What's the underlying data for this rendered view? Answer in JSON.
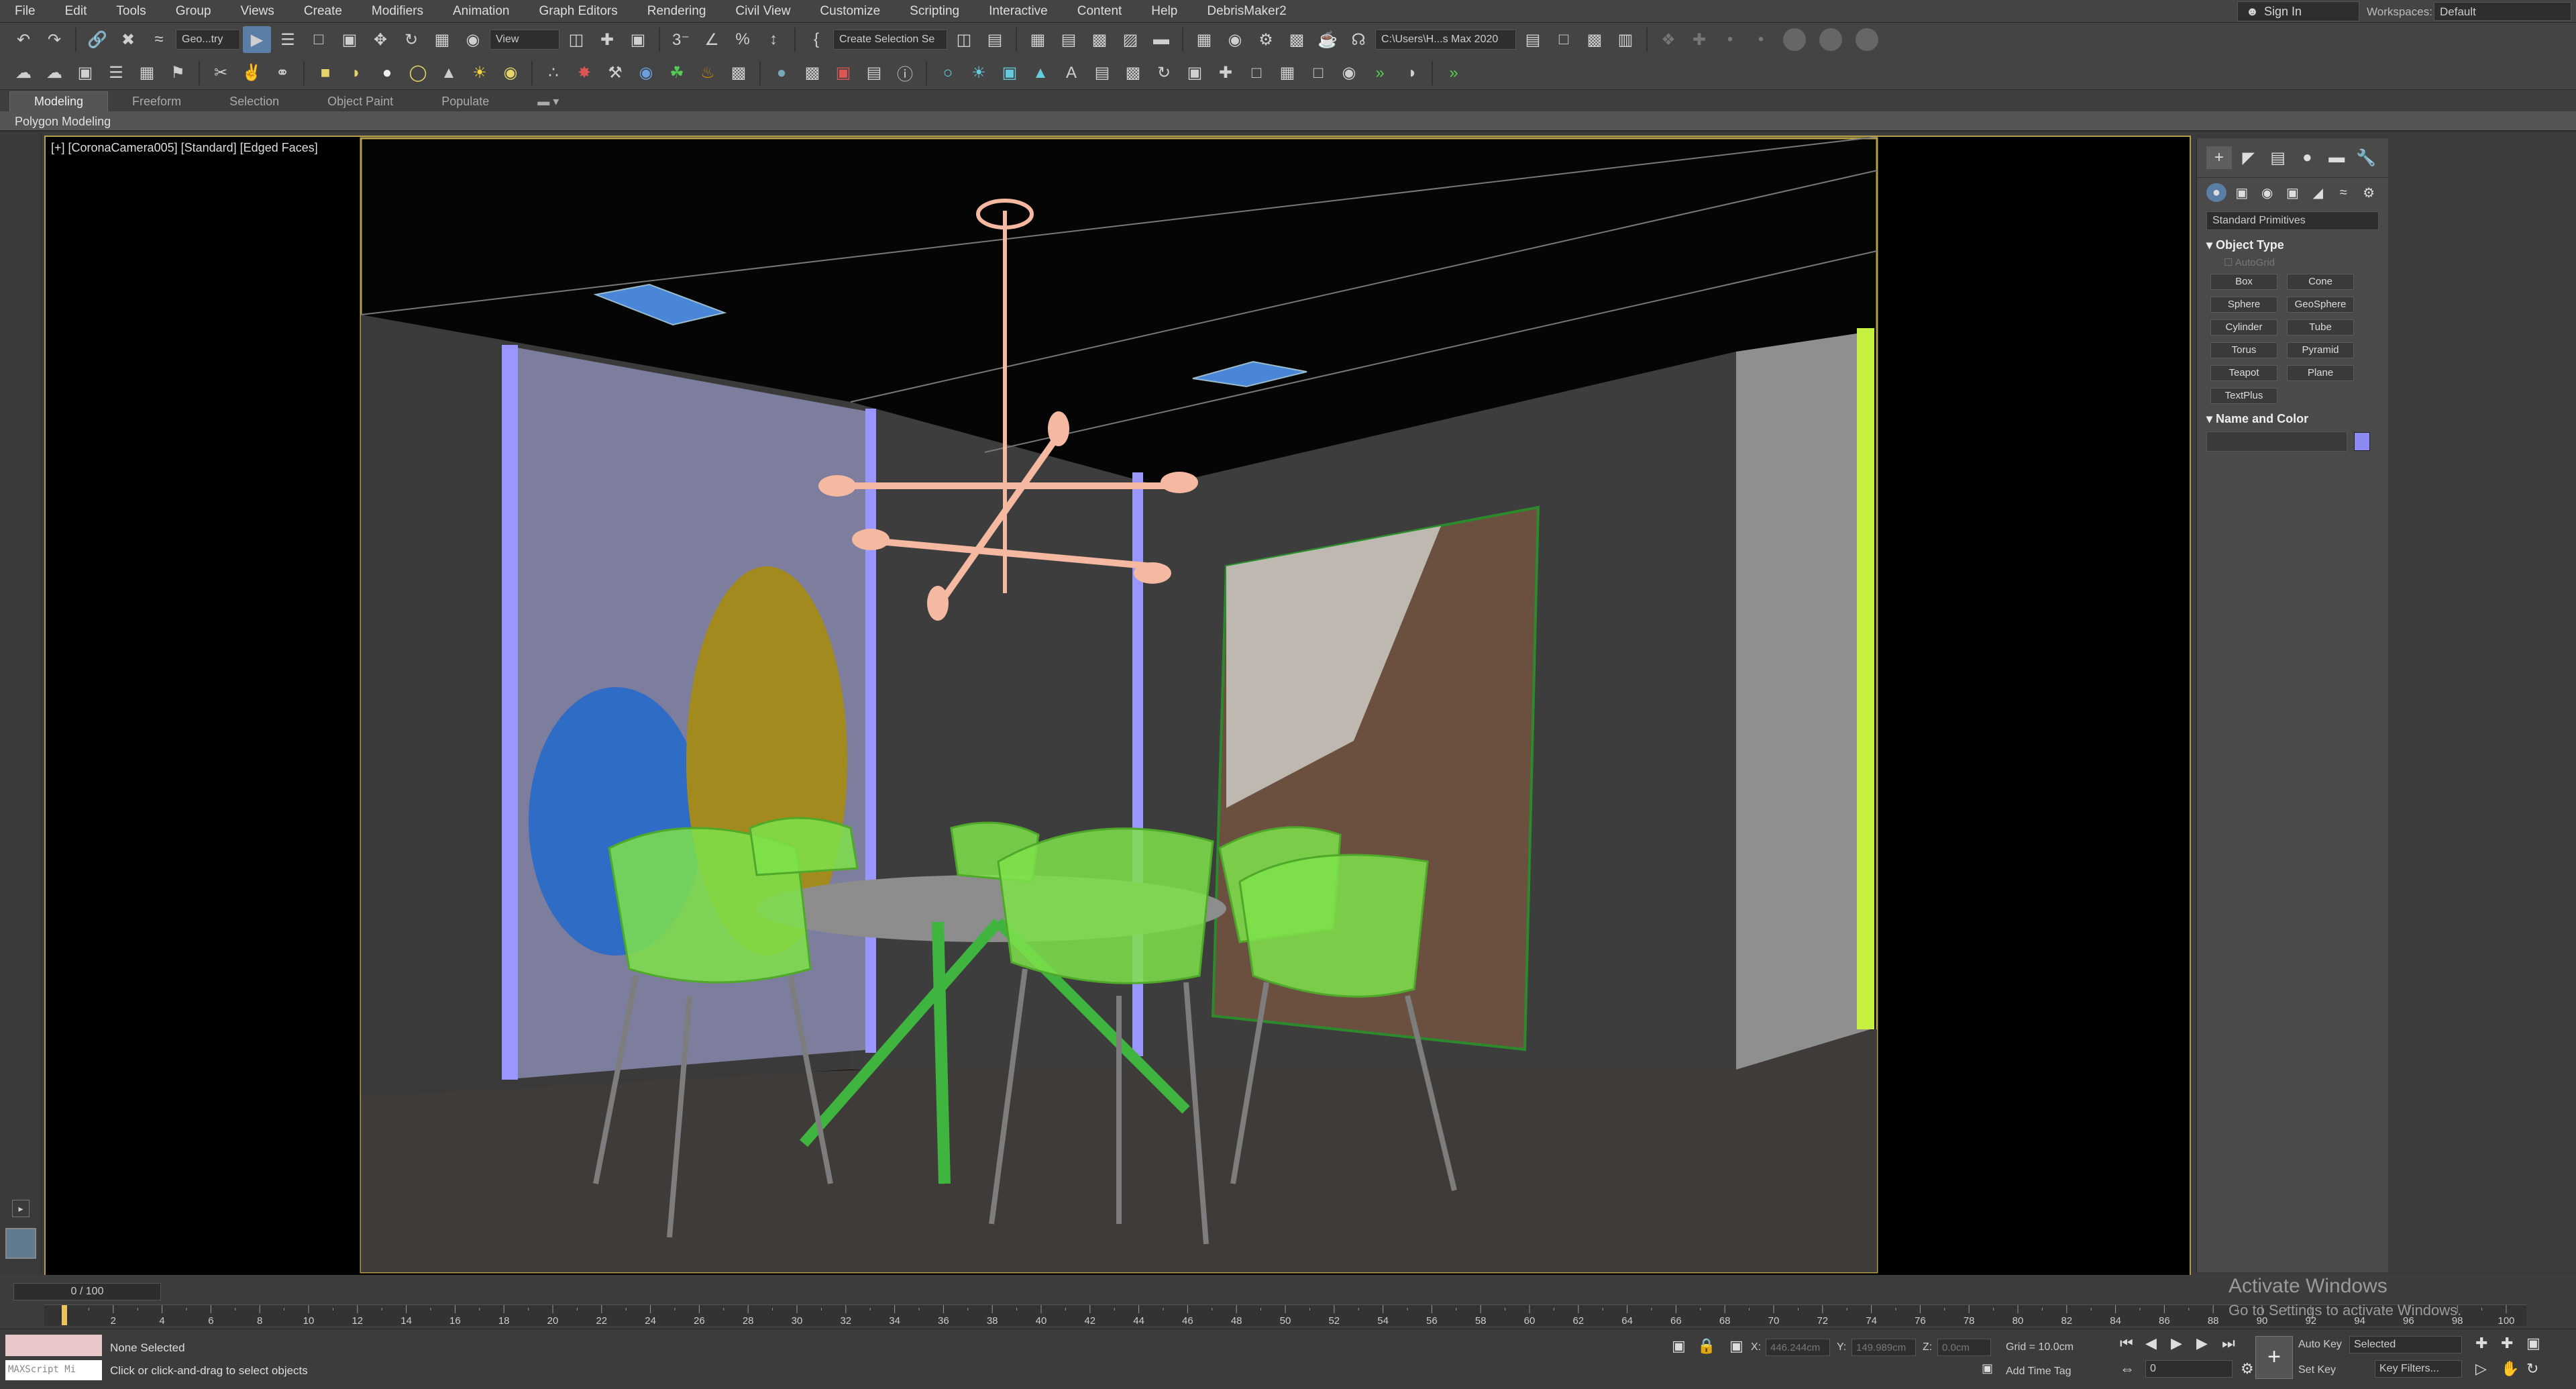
{
  "menu": [
    "File",
    "Edit",
    "Tools",
    "Group",
    "Views",
    "Create",
    "Modifiers",
    "Animation",
    "Graph Editors",
    "Rendering",
    "Civil View",
    "Customize",
    "Scripting",
    "Interactive",
    "Content",
    "Help",
    "DebrisMaker2"
  ],
  "account": {
    "signin": "Sign In",
    "workspaces_label": "Workspaces:",
    "workspace_value": "Default"
  },
  "toolbar1": {
    "filter": "Geo...try",
    "ref_coord": "View",
    "selection_set": "Create Selection Se",
    "project_path": "C:\\Users\\H...s Max 2020"
  },
  "ribbon": {
    "tabs": [
      "Modeling",
      "Freeform",
      "Selection",
      "Object Paint",
      "Populate"
    ],
    "panel_label": "Polygon Modeling"
  },
  "viewport": {
    "label": "[+] [CoronaCamera005] [Standard] [Edged Faces]"
  },
  "command_panel": {
    "dropdown": "Standard Primitives",
    "object_type_header": "Object Type",
    "autogrid": "AutoGrid",
    "buttons": [
      "Box",
      "Cone",
      "Sphere",
      "GeoSphere",
      "Cylinder",
      "Tube",
      "Torus",
      "Pyramid",
      "Teapot",
      "Plane",
      "TextPlus"
    ],
    "name_color_header": "Name and Color",
    "object_color": "#8c8af0"
  },
  "timeline": {
    "slider": "0 / 100",
    "ticks": [
      "0",
      "2",
      "4",
      "6",
      "8",
      "10",
      "12",
      "14",
      "16",
      "18",
      "20",
      "22",
      "24",
      "26",
      "28",
      "30",
      "32",
      "34",
      "36",
      "38",
      "40",
      "42",
      "44",
      "46",
      "48",
      "50",
      "52",
      "54",
      "56",
      "58",
      "60",
      "62",
      "64",
      "66",
      "68",
      "70",
      "72",
      "74",
      "76",
      "78",
      "80",
      "82",
      "84",
      "86",
      "88",
      "90",
      "92",
      "94",
      "96",
      "98",
      "100"
    ]
  },
  "status": {
    "maxscript": "MAXScript Mi",
    "selection": "None Selected",
    "prompt": "Click or click-and-drag to select objects",
    "x_label": "X:",
    "x_value": "446.244cm",
    "y_label": "Y:",
    "y_value": "149.989cm",
    "z_label": "Z:",
    "z_value": "0.0cm",
    "grid": "Grid = 10.0cm",
    "add_time_tag": "Add Time Tag",
    "auto_key": "Auto Key",
    "set_key": "Set Key",
    "key_mode": "Selected",
    "key_filters": "Key Filters...",
    "frame": "0"
  },
  "watermark": {
    "line1": "Activate Windows",
    "line2": "Go to Settings to activate Windows."
  },
  "icons": [
    "undo-icon",
    "redo-icon",
    "link-icon",
    "unlink-icon",
    "bind-space-warp-icon",
    "select-icon",
    "select-by-name-icon",
    "rect-region-icon",
    "window-crossing-icon",
    "move-icon",
    "rotate-icon",
    "scale-icon",
    "place-icon",
    "pivot-icon",
    "snap-icon",
    "angle-snap-icon",
    "percent-snap-icon",
    "spinner-snap-icon",
    "mirror-icon",
    "align-icon",
    "layer-icon",
    "ribbon-icon",
    "curve-editor-icon",
    "schematic-icon",
    "material-editor-icon",
    "render-setup-icon",
    "render-frame-icon",
    "render-icon"
  ]
}
